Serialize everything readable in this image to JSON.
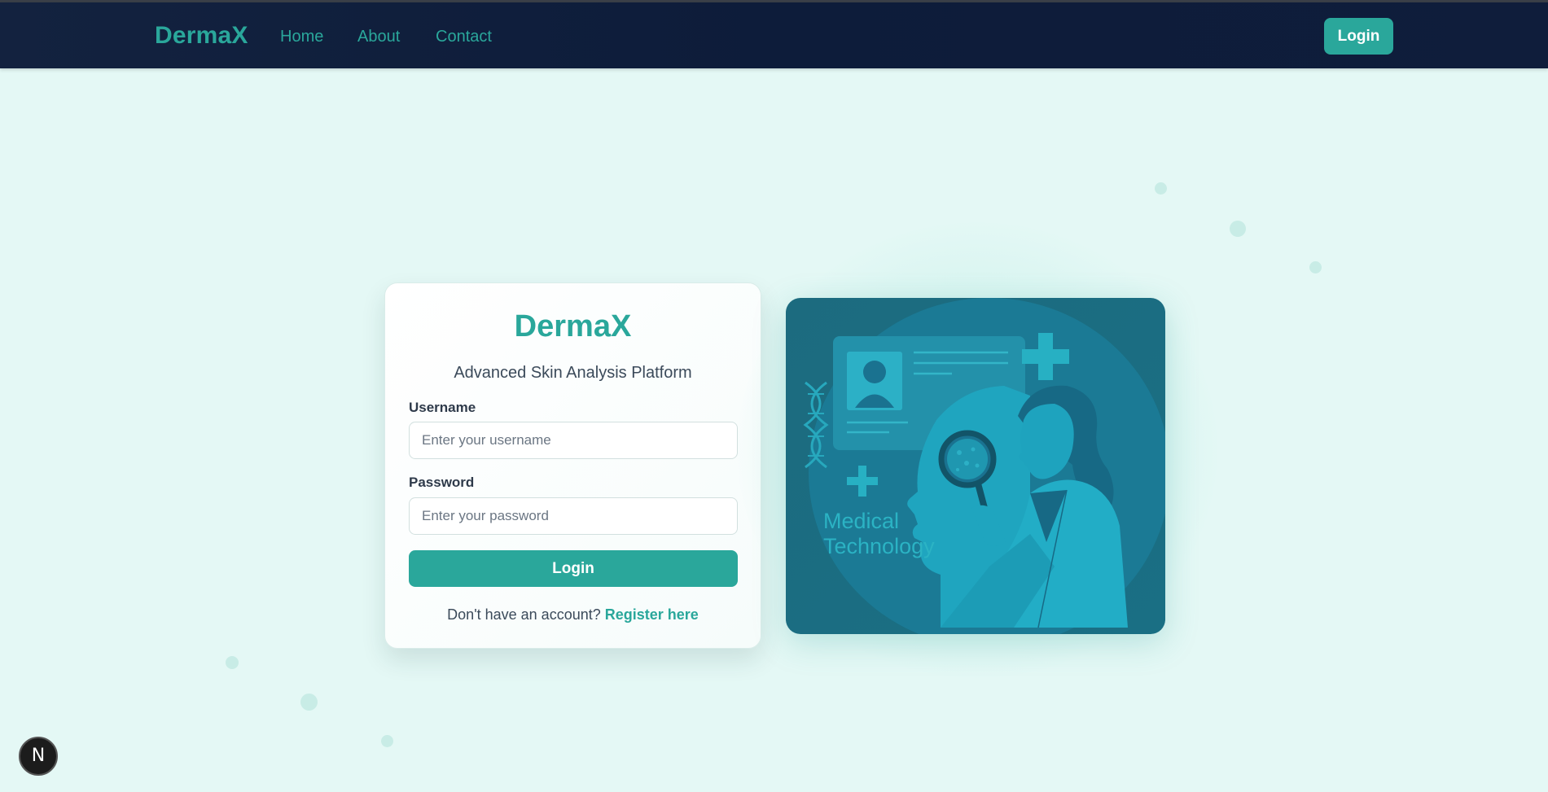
{
  "nav": {
    "brand": "DermaX",
    "links": [
      "Home",
      "About",
      "Contact"
    ],
    "login_label": "Login"
  },
  "login_card": {
    "title": "DermaX",
    "subtitle": "Advanced Skin Analysis Platform",
    "username_label": "Username",
    "username_placeholder": "Enter your username",
    "password_label": "Password",
    "password_placeholder": "Enter your password",
    "submit_label": "Login",
    "register_prompt": "Don't have an account?",
    "register_link": "Register here"
  },
  "illustration": {
    "line1": "Medical",
    "line2": "Technology"
  },
  "badge": {
    "label": "N"
  },
  "colors": {
    "accent": "#2aa79b",
    "navbar": "#0f1d3b",
    "background": "#e4f8f5",
    "illustration_bg": "#1e6f86"
  }
}
